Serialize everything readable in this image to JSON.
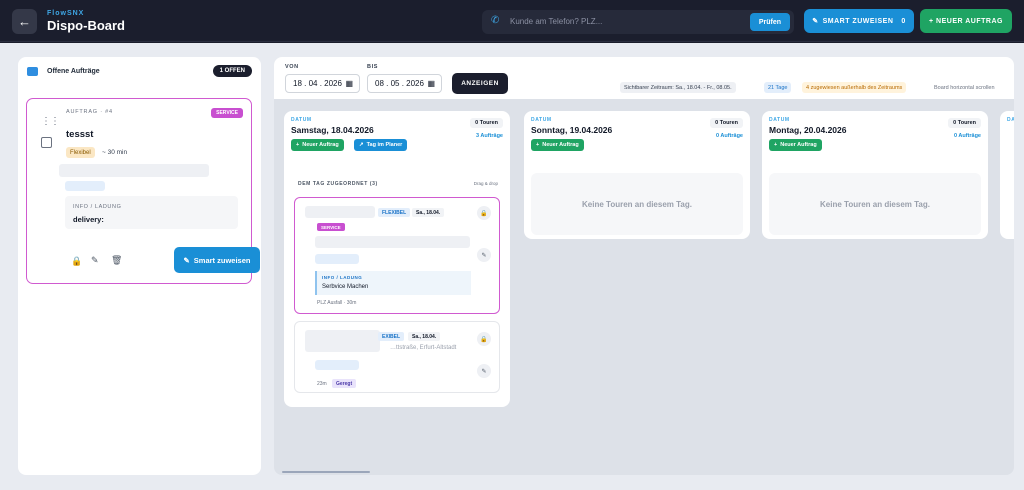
{
  "header": {
    "brand_small": "FlowSNX",
    "title": "Dispo-Board",
    "search_placeholder": "Kunde am Telefon? PLZ...",
    "search_button": "Prüfen",
    "smart_button": "SMART ZUWEISEN",
    "smart_count": "0",
    "new_button": "+ NEUER AUFTRAG"
  },
  "left_panel": {
    "title": "Offene Aufträge",
    "badge": "1 OFFEN",
    "order": {
      "label": "AUFTRAG · #4",
      "type_badge": "SERVICE",
      "name": "tessst",
      "flex_badge": "Flexibel",
      "duration": "~ 30 min",
      "info_title": "INFO / LADUNG",
      "info_value": "delivery:",
      "smart_button": "Smart zuweisen"
    }
  },
  "filters": {
    "von_label": "VON",
    "von_value": "18 . 04 . 2026",
    "bis_label": "BIS",
    "bis_value": "08 . 05 . 2026",
    "show_button": "ANZEIGEN",
    "zeitraum": "Sichtbarer Zeitraum: Sa., 18.04. - Fr., 08.05.",
    "tage": "21 Tage",
    "ausserhalb": "4 zugewiesen außerhalb des Zeitraums",
    "scroll_hint": "Board horizontal scrollen"
  },
  "days": [
    {
      "datum_label": "DATUM",
      "date": "Samstag, 18.04.2026",
      "touren": "0 Touren",
      "auftraege": "3 Aufträge",
      "new_button": "Neuer Auftrag",
      "planer_button": "Tag im Planer",
      "assigned_header": "DEM TAG ZUGEORDNET (3)",
      "assigned_hint": "Drag & drop",
      "cards": [
        {
          "flex": "FLEXIBEL",
          "day": "Sa., 18.04.",
          "type": "SERVICE",
          "info_title": "INFO / LADUNG",
          "info_value": "Serbvice Machen",
          "footer": "PLZ Ausfall · 30m"
        },
        {
          "flex": "EXIBEL",
          "day": "Sa., 18.04.",
          "street": "…ttstraße, Erfurt-Altstadt",
          "duration": "23m",
          "status": "Geregt"
        }
      ]
    },
    {
      "datum_label": "DATUM",
      "date": "Sonntag, 19.04.2026",
      "touren": "0 Touren",
      "auftraege": "0 Aufträge",
      "new_button": "Neuer Auftrag",
      "empty_text": "Keine Touren an diesem Tag."
    },
    {
      "datum_label": "DATUM",
      "date": "Montag, 20.04.2026",
      "touren": "0 Touren",
      "auftraege": "0 Aufträge",
      "new_button": "Neuer Auftrag",
      "empty_text": "Keine Touren an diesem Tag."
    },
    {
      "datum_label": "DA"
    }
  ]
}
